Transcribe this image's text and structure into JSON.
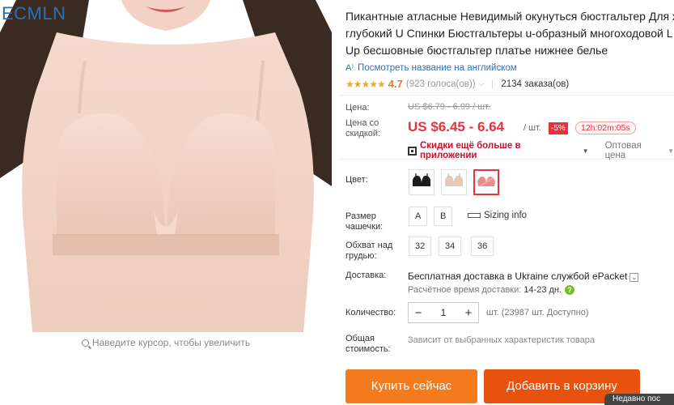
{
  "gallery": {
    "watermark": "ECMLN",
    "zoom_hint": "Наведите курсор, чтобы увеличить"
  },
  "product": {
    "title_line1": "Пикантные атласные Невидимый окунуться бюстгальтер Для ж",
    "title_line2": "глубокий U Спинки Бюстгальтеры u-образный многоходовой L",
    "title_line3": "Up бесшовные бюстгальтер платье нижнее белье",
    "translate_link": "Посмотреть название на английском",
    "rating_value": "4.7",
    "rating_fraction": 0.94,
    "votes": "(923 голоса(ов))",
    "orders": "2134 заказа(ов)"
  },
  "price": {
    "price_label": "Цена:",
    "old_price": "US $6.79 - 6.99 / шт.",
    "sale_label_line1": "Цена со",
    "sale_label_line2": "скидкой:",
    "new_price": "US $6.45 - 6.64",
    "per_unit": "/ шт.",
    "discount": "-5%",
    "timer": "12h:02m:05s",
    "app_discount": "Скидки ещё больше в приложении",
    "wholesale": "Оптовая цена"
  },
  "options": {
    "color_label": "Цвет:",
    "color_swatches": [
      "black",
      "nude",
      "pink"
    ],
    "cup_label_line1": "Размер",
    "cup_label_line2": "чашечки:",
    "cup_sizes": [
      "A",
      "B"
    ],
    "sizing_info": "Sizing info",
    "band_label_line1": "Обхват над",
    "band_label_line2": "грудью:",
    "band_sizes": [
      "32",
      "34",
      "36"
    ]
  },
  "shipping": {
    "label": "Доставка:",
    "free_text": "Бесплатная доставка в Ukraine службой ePacket",
    "estimate_label": "Расчётное время доставки:",
    "estimate_days": "14-23 дн."
  },
  "quantity": {
    "label": "Количество:",
    "value": "1",
    "minus": "−",
    "plus": "+",
    "stock": "шт. (23987 шт. Доступно)"
  },
  "total": {
    "label_line1": "Общая",
    "label_line2": "стоимость:",
    "note": "Зависит от выбранных характеристик товара"
  },
  "actions": {
    "buy_now": "Купить сейчас",
    "add_to_cart": "Добавить в корзину",
    "corner_tip": "Недавно пос"
  },
  "colors": {
    "price_red": "#e8323a",
    "buy_orange": "#f37b1d",
    "cart_orange": "#e8520f",
    "rating_orange": "#e8782c",
    "link_blue": "#2f6fba"
  }
}
